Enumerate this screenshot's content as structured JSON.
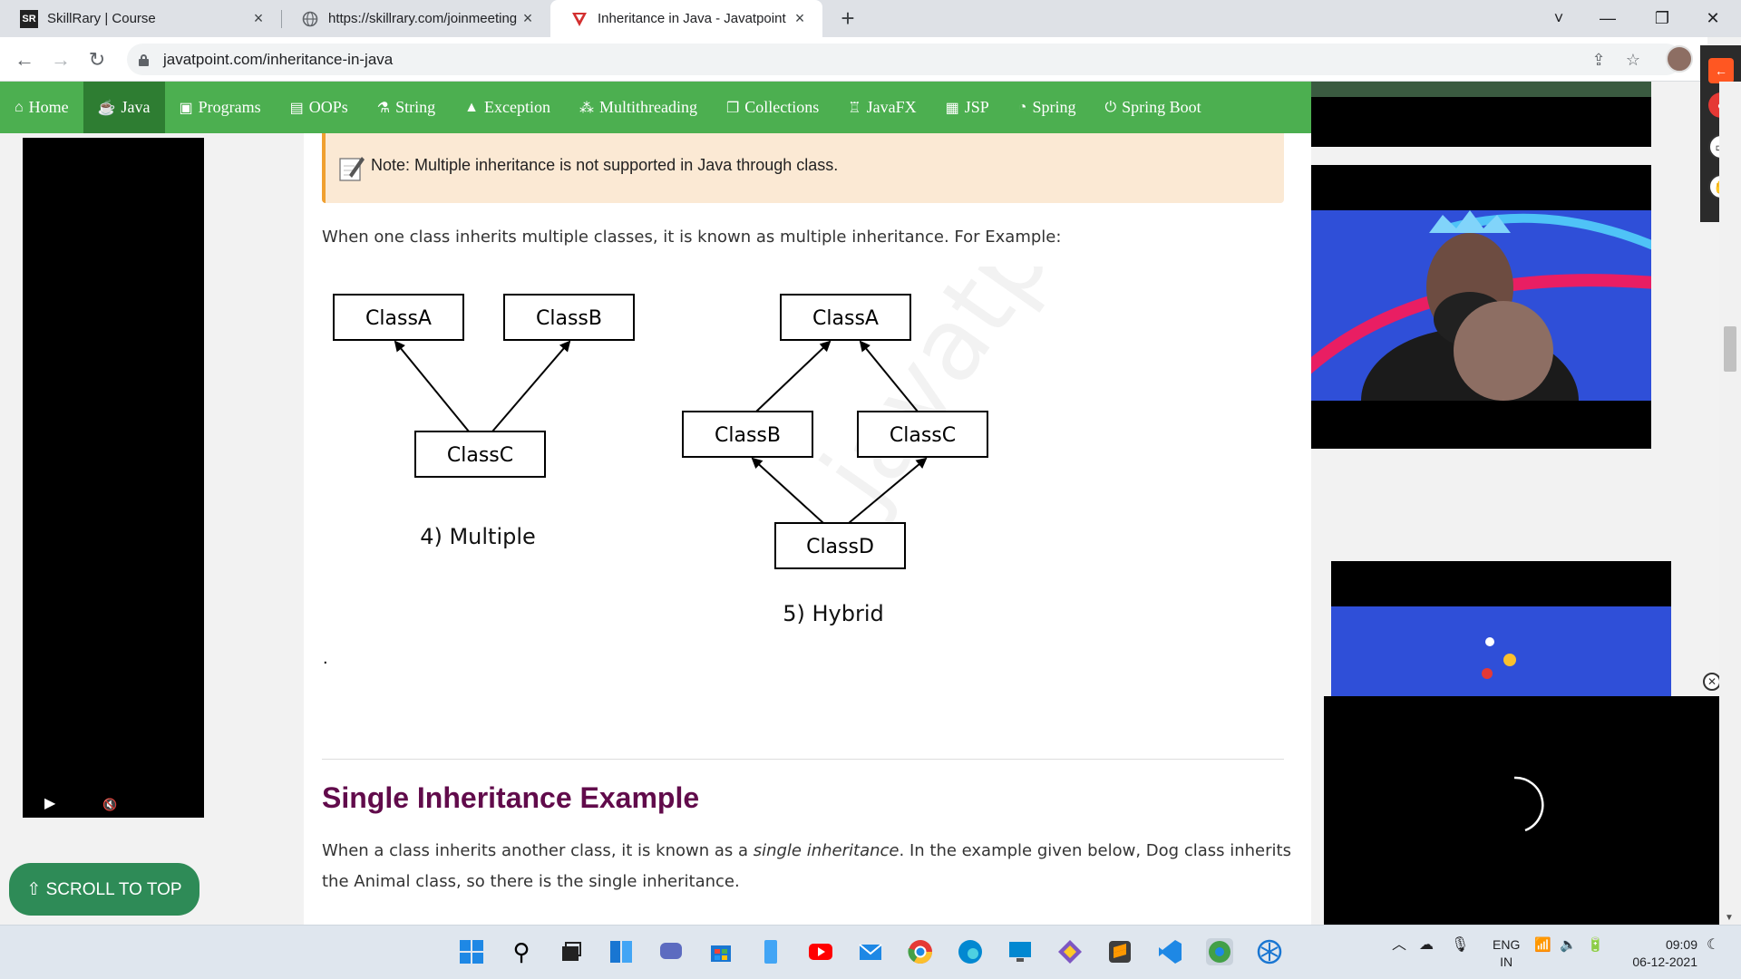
{
  "browser": {
    "tabs": [
      {
        "favicon": "SR",
        "title": "SkillRary | Course",
        "close": "×"
      },
      {
        "favicon": "globe-icon",
        "title": "https://skillrary.com/joinmeeting",
        "close": "×"
      },
      {
        "favicon": "javatpoint-logo",
        "title": "Inheritance in Java - Javatpoint",
        "close": "×"
      }
    ],
    "new_tab": "+",
    "url": "javatpoint.com/inheritance-in-java",
    "window_controls": [
      "˅",
      "—",
      "❐",
      "✕"
    ]
  },
  "site_nav": {
    "items": [
      {
        "label": "Home",
        "icon": "house-icon"
      },
      {
        "label": "Java",
        "icon": "coffee-icon",
        "active": true
      },
      {
        "label": "Programs",
        "icon": "monitor-icon"
      },
      {
        "label": "OOPs",
        "icon": "image-icon"
      },
      {
        "label": "String",
        "icon": "flask-icon"
      },
      {
        "label": "Exception",
        "icon": "warning-icon"
      },
      {
        "label": "Multithreading",
        "icon": "network-icon"
      },
      {
        "label": "Collections",
        "icon": "cards-icon"
      },
      {
        "label": "JavaFX",
        "icon": "robot-icon"
      },
      {
        "label": "JSP",
        "icon": "screen-icon"
      },
      {
        "label": "Spring",
        "icon": "leaf-icon"
      },
      {
        "label": "Spring Boot",
        "icon": "power-icon"
      }
    ],
    "active_color": "#2e7d32",
    "bar_color": "#4caf50"
  },
  "content": {
    "note": "Note: Multiple inheritance is not supported in Java through class.",
    "intro": "When one class inherits multiple classes, it is known as multiple inheritance. For Example:",
    "diagram": {
      "multiple": {
        "top": [
          "ClassA",
          "ClassB"
        ],
        "bottom": "ClassC",
        "caption": "4) Multiple"
      },
      "hybrid": {
        "top": "ClassA",
        "middle": [
          "ClassB",
          "ClassC"
        ],
        "bottom": "ClassD",
        "caption": "5) Hybrid"
      },
      "watermark": "javatpoint"
    },
    "dot": ".",
    "section_title": "Single Inheritance Example",
    "single_para_before": "When a class inherits another class, it is known as a ",
    "single_para_em": "single inheritance",
    "single_para_after": ". In the example given below, Dog class inherits the Animal class, so there is the single inheritance.",
    "title_color": "#610b4b"
  },
  "scroll_top": "⇧ SCROLL TO TOP",
  "left_video": {
    "play": "▶",
    "mute": "🔇"
  },
  "taskbar": {
    "lang": "ENG",
    "region": "IN",
    "time": "09:09",
    "date": "06-12-2021"
  }
}
